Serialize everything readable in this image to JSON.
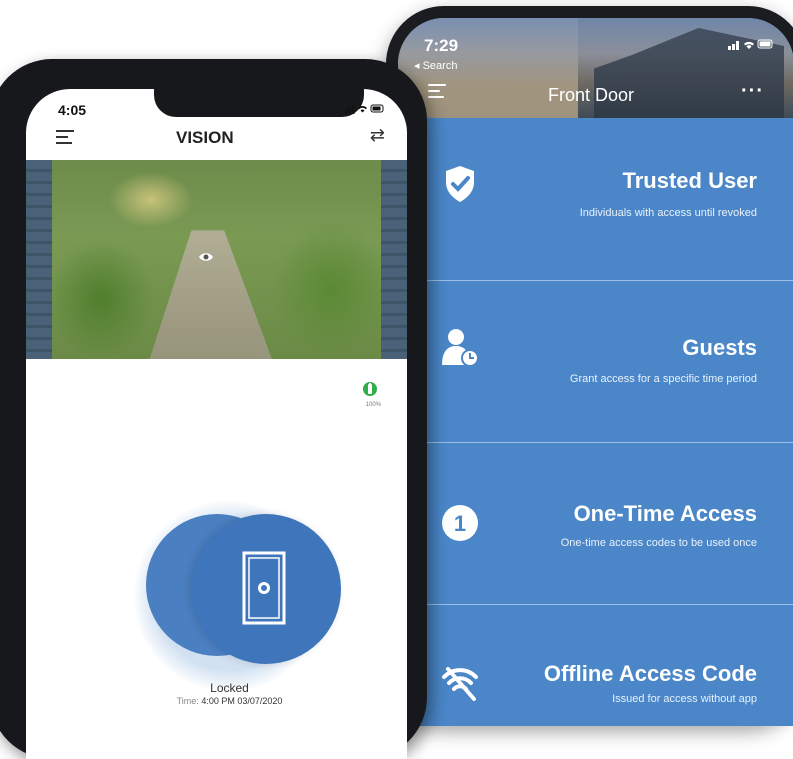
{
  "back_phone": {
    "status_time": "7:29",
    "status_back": "◂ Search",
    "status_icons": "📶 ᯤ ▭",
    "header_title": "Front Door",
    "more_label": "···",
    "cards": [
      {
        "icon": "shield-check-icon",
        "title": "Trusted User",
        "subtitle": "Individuals with access until revoked"
      },
      {
        "icon": "guest-clock-icon",
        "title": "Guests",
        "subtitle": "Grant access for a specific time period"
      },
      {
        "icon": "number-one-icon",
        "title": "One-Time Access",
        "subtitle": "One-time access codes to be used once"
      },
      {
        "icon": "no-wifi-icon",
        "title": "Offline Access Code",
        "subtitle": "Issued for access without app"
      }
    ]
  },
  "front_phone": {
    "status_time": "4:05",
    "status_icons": "📶 ᯤ ▭",
    "header_title": "VISION",
    "swap_label": "⇄",
    "battery_pct": "100%",
    "lock_status": "Locked",
    "lock_time_label": "Time:",
    "lock_time_value": "4:00 PM 03/07/2020"
  },
  "colors": {
    "accent_blue": "#4a86c8",
    "lock_blue": "#3f76bb",
    "battery_green": "#2fae4a"
  }
}
